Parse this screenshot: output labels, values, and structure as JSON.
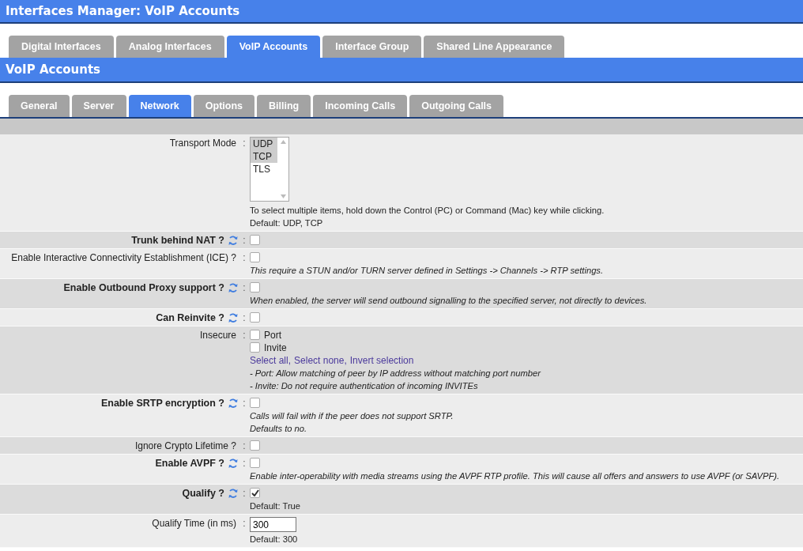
{
  "header": {
    "title": "Interfaces Manager:  VoIP Accounts"
  },
  "main_tabs": [
    {
      "label": "Digital Interfaces",
      "selected": false
    },
    {
      "label": "Analog Interfaces",
      "selected": false
    },
    {
      "label": "VoIP Accounts",
      "selected": true
    },
    {
      "label": "Interface Group",
      "selected": false
    },
    {
      "label": "Shared Line Appearance",
      "selected": false
    }
  ],
  "section": {
    "title": "VoIP Accounts"
  },
  "sub_tabs": [
    {
      "label": "General",
      "selected": false
    },
    {
      "label": "Server",
      "selected": false
    },
    {
      "label": "Network",
      "selected": true
    },
    {
      "label": "Options",
      "selected": false
    },
    {
      "label": "Billing",
      "selected": false
    },
    {
      "label": "Incoming Calls",
      "selected": false
    },
    {
      "label": "Outgoing Calls",
      "selected": false
    }
  ],
  "separator": ":",
  "rows": [
    {
      "kind": "listbox",
      "label": "Transport Mode",
      "bold": false,
      "refresh": false,
      "options": [
        {
          "label": "UDP",
          "selected": true
        },
        {
          "label": "TCP",
          "selected": true
        },
        {
          "label": "TLS",
          "selected": false
        }
      ],
      "notes": [
        {
          "text": "To select multiple items, hold down the Control (PC) or Command (Mac) key while clicking.",
          "italic": false
        },
        {
          "text": "Default: UDP, TCP",
          "italic": false
        }
      ]
    },
    {
      "kind": "checkbox",
      "label": "Trunk behind NAT ?",
      "bold": true,
      "refresh": true,
      "checked": false
    },
    {
      "kind": "checkbox",
      "label": "Enable Interactive Connectivity Establishment (ICE) ?",
      "bold": false,
      "refresh": false,
      "checked": false,
      "notes": [
        {
          "text": "This require a STUN and/or TURN server defined in Settings -> Channels -> RTP settings.",
          "italic": true
        }
      ]
    },
    {
      "kind": "checkbox",
      "label": "Enable Outbound Proxy support ?",
      "bold": true,
      "refresh": true,
      "checked": false,
      "notes": [
        {
          "text": "When enabled, the server will send outbound signalling to the specified server, not directly to devices.",
          "italic": true
        }
      ]
    },
    {
      "kind": "checkbox",
      "label": "Can Reinvite ?",
      "bold": true,
      "refresh": true,
      "checked": false
    },
    {
      "kind": "checkgroup",
      "label": "Insecure",
      "bold": false,
      "refresh": false,
      "items": [
        {
          "label": "Port",
          "checked": false
        },
        {
          "label": "Invite",
          "checked": false
        }
      ],
      "links": [
        "Select all,",
        "Select none,",
        "Invert selection"
      ],
      "notes": [
        {
          "text": "- Port: Allow matching of peer by IP address without matching port number",
          "italic": true
        },
        {
          "text": "- Invite: Do not require authentication of incoming INVITEs",
          "italic": true
        }
      ]
    },
    {
      "kind": "checkbox",
      "label": "Enable SRTP encryption ?",
      "bold": true,
      "refresh": true,
      "checked": false,
      "notes": [
        {
          "text": "Calls will fail with if the peer does not support SRTP.",
          "italic": true
        },
        {
          "text": "Defaults to no.",
          "italic": true
        }
      ]
    },
    {
      "kind": "checkbox",
      "label": "Ignore Crypto Lifetime ?",
      "bold": false,
      "refresh": false,
      "checked": false
    },
    {
      "kind": "checkbox",
      "label": "Enable AVPF ?",
      "bold": true,
      "refresh": true,
      "checked": false,
      "notes": [
        {
          "text": "Enable inter-operability with media streams using the AVPF RTP profile. This will cause all offers and answers to use AVPF (or SAVPF).",
          "italic": true
        }
      ]
    },
    {
      "kind": "checkbox",
      "label": "Qualify ?",
      "bold": true,
      "refresh": true,
      "checked": true,
      "notes": [
        {
          "text": "Default: True",
          "italic": false
        }
      ]
    },
    {
      "kind": "text",
      "label": "Qualify Time (in ms)",
      "bold": false,
      "refresh": false,
      "value": "300",
      "notes": [
        {
          "text": "Default: 300",
          "italic": false
        }
      ]
    }
  ]
}
